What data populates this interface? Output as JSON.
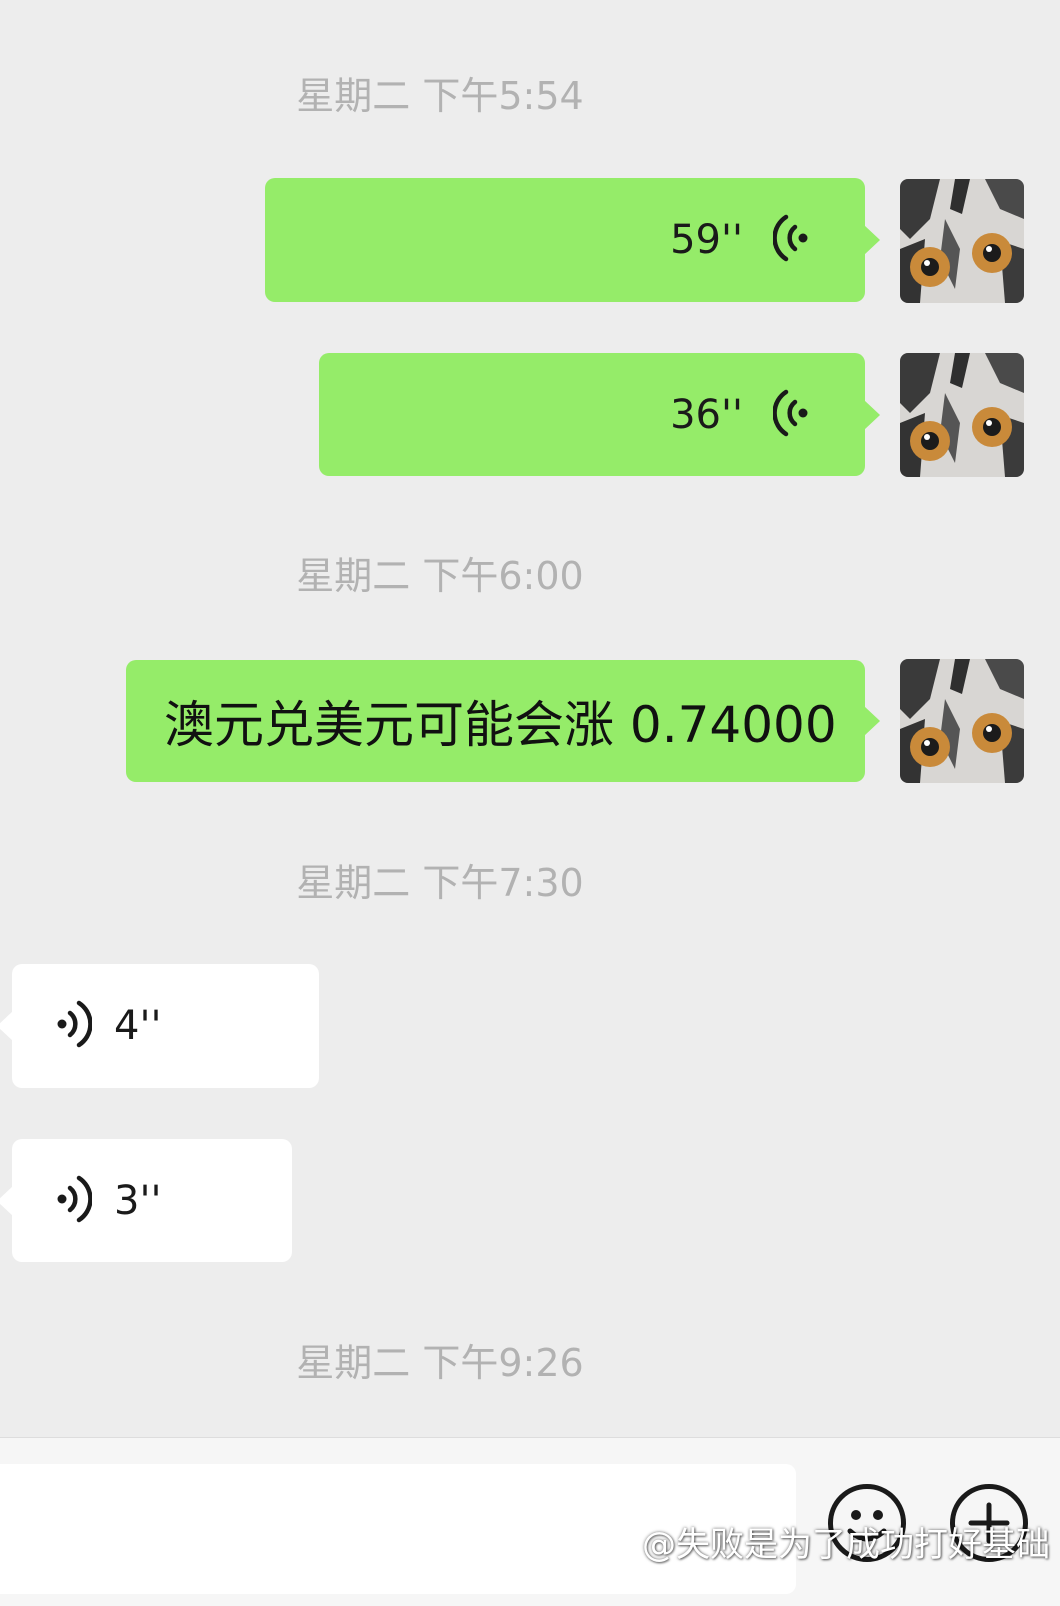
{
  "chat": {
    "timestamps": [
      "星期二 下午5:54",
      "星期二 下午6:00",
      "星期二 下午7:30",
      "星期二 下午9:26"
    ],
    "messages": [
      {
        "from": "me",
        "kind": "voice",
        "duration": "59''"
      },
      {
        "from": "me",
        "kind": "voice",
        "duration": "36''"
      },
      {
        "from": "me",
        "kind": "text",
        "text": "澳元兑美元可能会涨 0.74000"
      },
      {
        "from": "other",
        "kind": "voice",
        "duration": "4''"
      },
      {
        "from": "other",
        "kind": "voice",
        "duration": "3''"
      }
    ]
  },
  "input_bar": {
    "emoji_button_icon": "emoji-smiley-icon",
    "more_button_icon": "plus-icon"
  },
  "watermark": {
    "text": "@失败是为了成功打好基础"
  },
  "colors": {
    "background": "#ededed",
    "my_bubble": "#95ec69",
    "other_bubble": "#ffffff",
    "timestamp": "#b2b2b2"
  }
}
